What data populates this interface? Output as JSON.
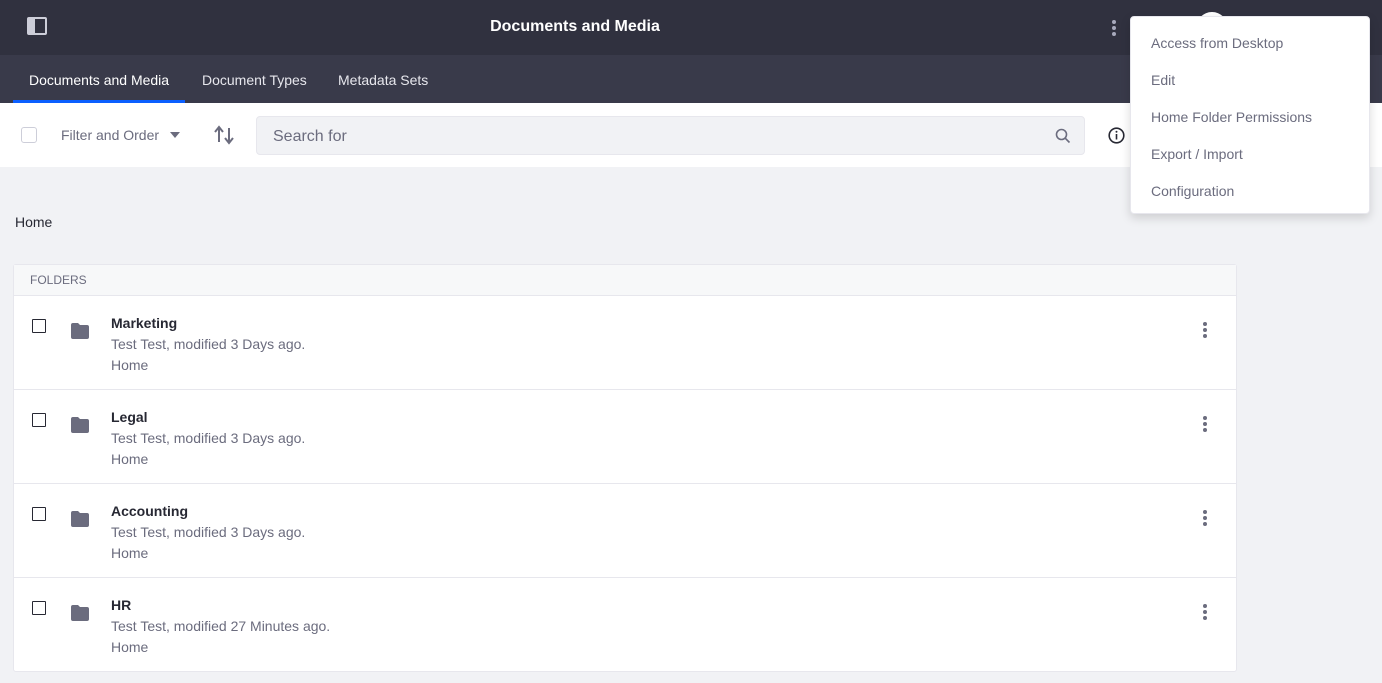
{
  "header": {
    "title": "Documents and Media",
    "sidebar_toggle_icon": "sidebar-panel-icon",
    "options_icon": "kebab-vertical-icon"
  },
  "nav": {
    "tabs": [
      {
        "label": "Documents and Media",
        "active": true
      },
      {
        "label": "Document Types",
        "active": false
      },
      {
        "label": "Metadata Sets",
        "active": false
      }
    ]
  },
  "toolbar": {
    "filter_label": "Filter and Order",
    "search_placeholder": "Search for",
    "sort_icon": "sort-arrows-icon",
    "search_icon": "search-icon",
    "info_icon": "info-icon"
  },
  "breadcrumb": {
    "current": "Home"
  },
  "folders": {
    "header": "FOLDERS",
    "items": [
      {
        "name": "Marketing",
        "meta": "Test Test, modified 3 Days ago.",
        "location": "Home"
      },
      {
        "name": "Legal",
        "meta": "Test Test, modified 3 Days ago.",
        "location": "Home"
      },
      {
        "name": "Accounting",
        "meta": "Test Test, modified 3 Days ago.",
        "location": "Home"
      },
      {
        "name": "HR",
        "meta": "Test Test, modified 27 Minutes ago.",
        "location": "Home"
      }
    ]
  },
  "dropdown": {
    "items": [
      {
        "label": "Access from Desktop"
      },
      {
        "label": "Edit"
      },
      {
        "label": "Home Folder Permissions"
      },
      {
        "label": "Export / Import"
      },
      {
        "label": "Configuration"
      }
    ]
  },
  "colors": {
    "topbar": "#30313f",
    "navbar": "#393a4a",
    "accent": "#0b5fff",
    "background": "#f1f2f5"
  }
}
